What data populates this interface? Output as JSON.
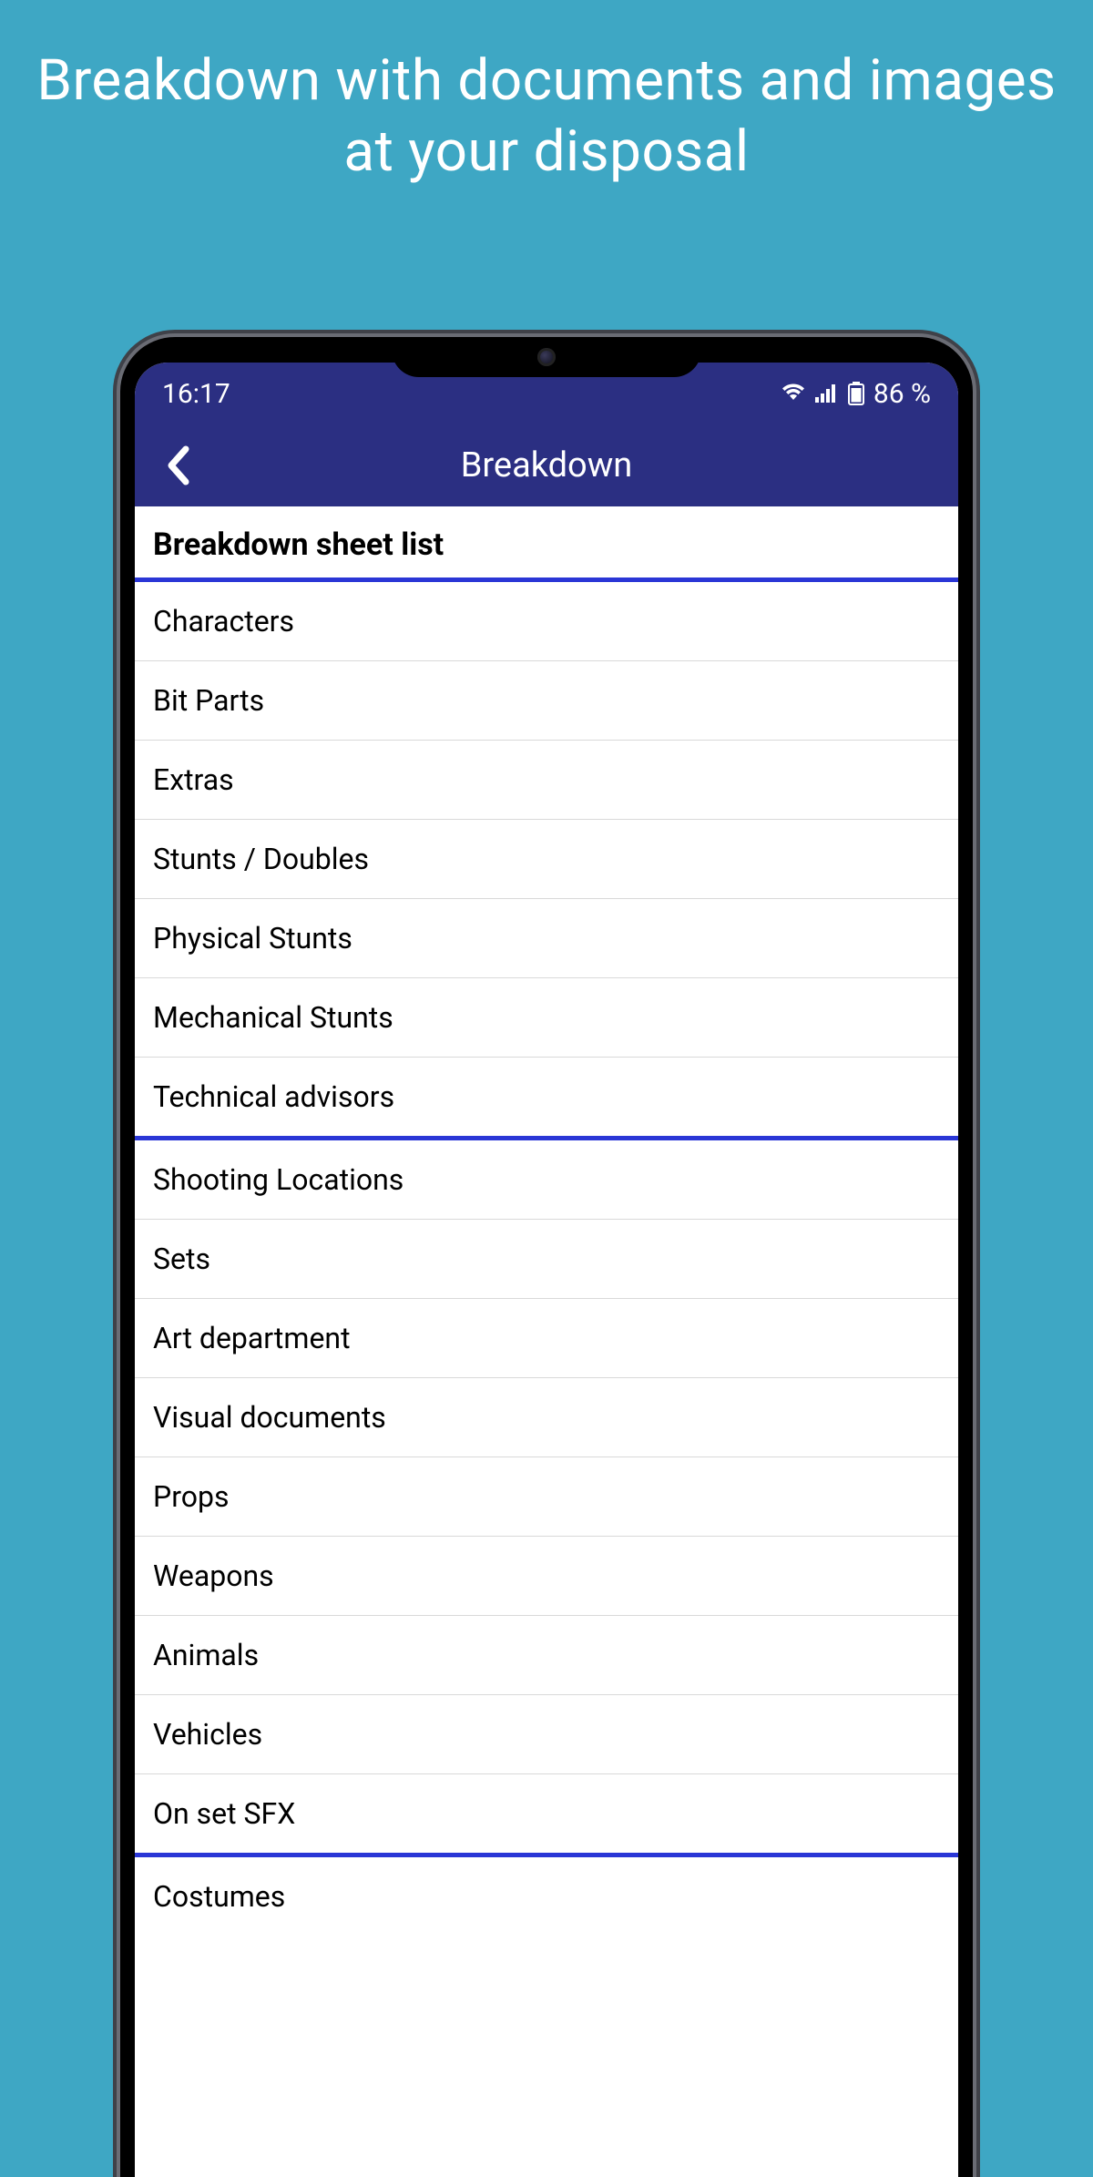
{
  "promo": {
    "title": "Breakdown with documents and images at your disposal"
  },
  "statusBar": {
    "time": "16:17",
    "batteryText": "86 %"
  },
  "appBar": {
    "title": "Breakdown"
  },
  "list": {
    "sectionHeader": "Breakdown sheet list",
    "items": [
      {
        "label": "Characters",
        "groupEnd": false
      },
      {
        "label": "Bit Parts",
        "groupEnd": false
      },
      {
        "label": "Extras",
        "groupEnd": false
      },
      {
        "label": "Stunts / Doubles",
        "groupEnd": false
      },
      {
        "label": "Physical Stunts",
        "groupEnd": false
      },
      {
        "label": "Mechanical Stunts",
        "groupEnd": false
      },
      {
        "label": "Technical advisors",
        "groupEnd": true
      },
      {
        "label": "Shooting Locations",
        "groupEnd": false
      },
      {
        "label": "Sets",
        "groupEnd": false
      },
      {
        "label": "Art department",
        "groupEnd": false
      },
      {
        "label": "Visual documents",
        "groupEnd": false
      },
      {
        "label": "Props",
        "groupEnd": false
      },
      {
        "label": "Weapons",
        "groupEnd": false
      },
      {
        "label": "Animals",
        "groupEnd": false
      },
      {
        "label": "Vehicles",
        "groupEnd": false
      },
      {
        "label": "On set SFX",
        "groupEnd": true
      }
    ],
    "partialItem": "Costumes"
  }
}
